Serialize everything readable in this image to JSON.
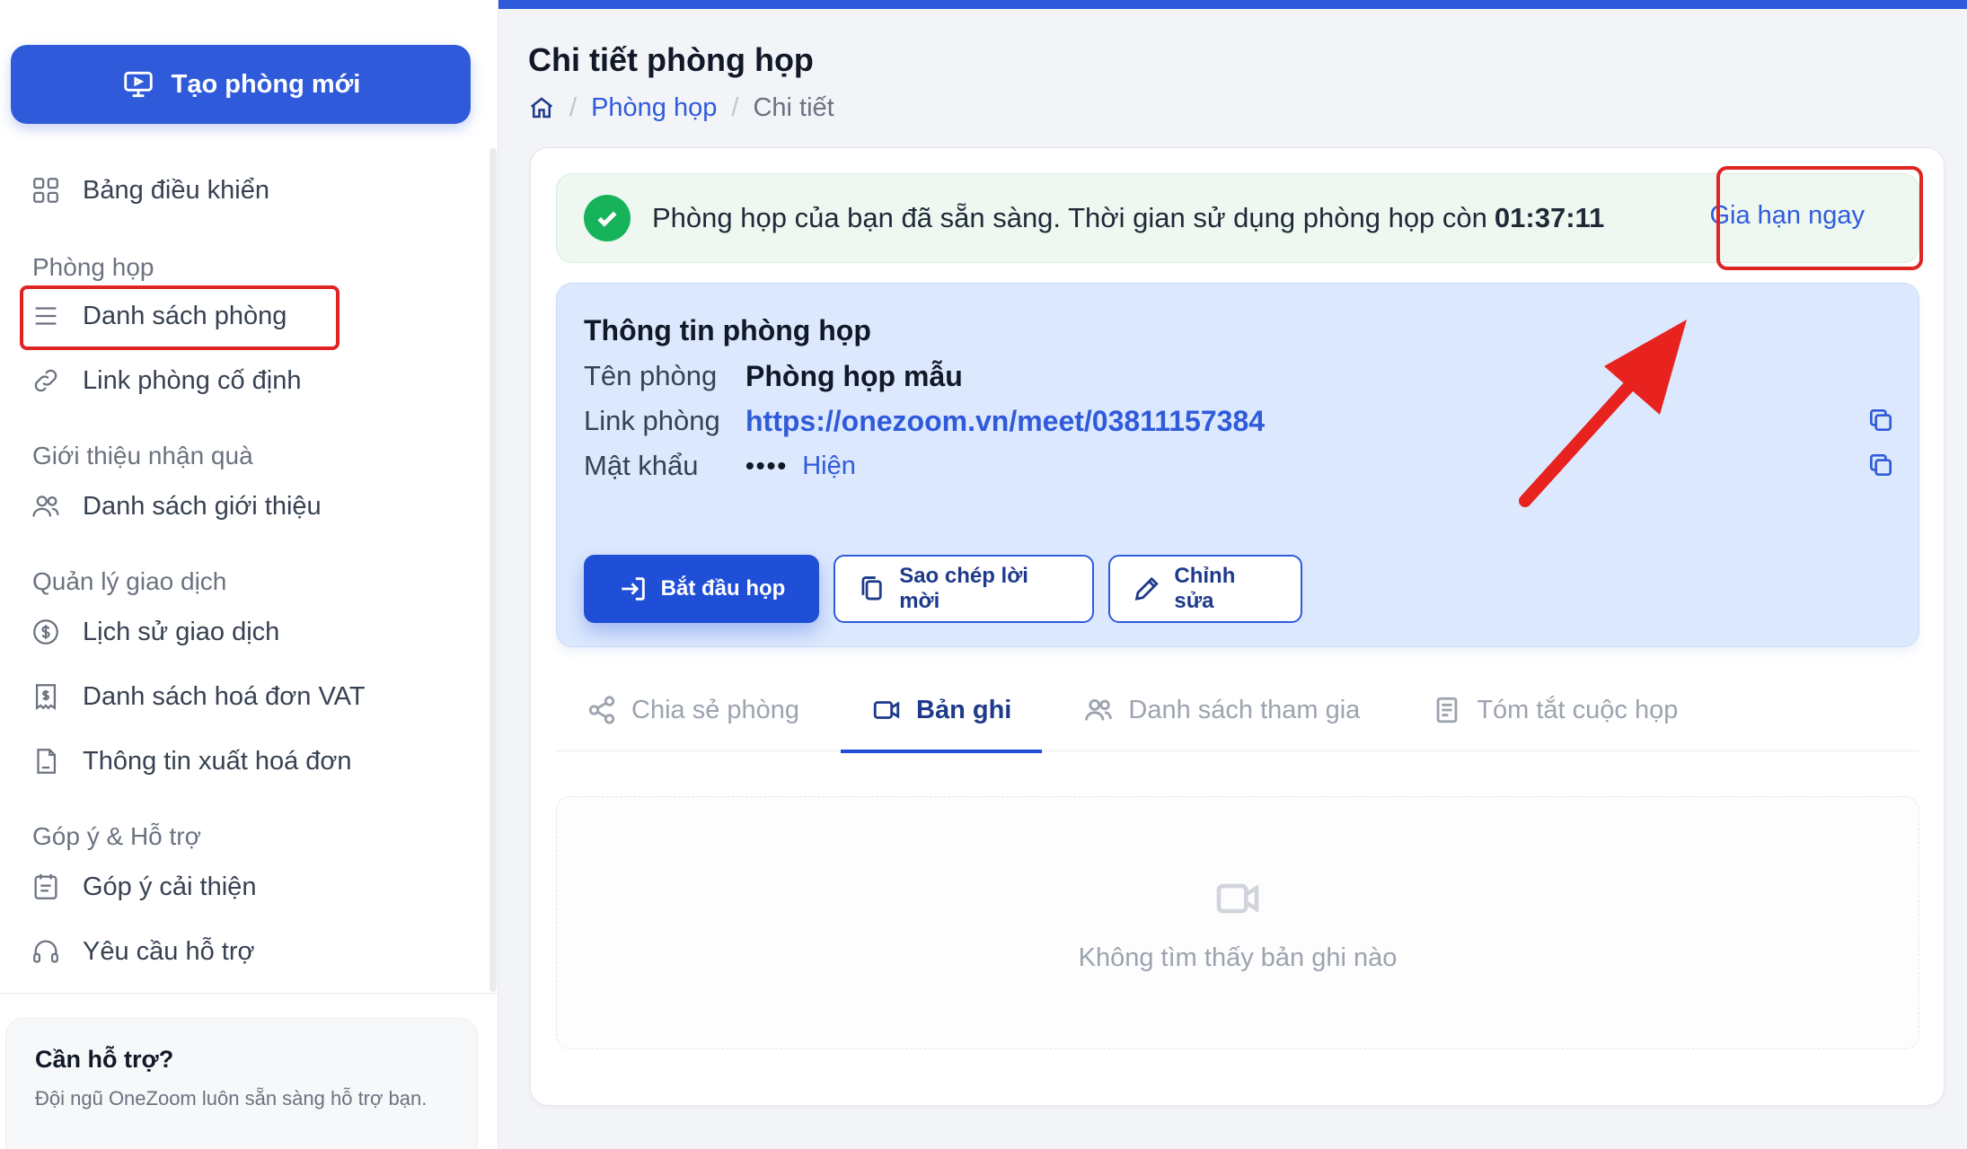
{
  "sidebar": {
    "create_button": "Tạo phòng mới",
    "dashboard": "Bảng điều khiển",
    "sections": [
      {
        "title": "Phòng họp",
        "items": [
          "Danh sách phòng",
          "Link phòng cố định"
        ]
      },
      {
        "title": "Giới thiệu nhận quà",
        "items": [
          "Danh sách giới thiệu"
        ]
      },
      {
        "title": "Quản lý giao dịch",
        "items": [
          "Lịch sử giao dịch",
          "Danh sách hoá đơn VAT",
          "Thông tin xuất hoá đơn"
        ]
      },
      {
        "title": "Góp ý & Hỗ trợ",
        "items": [
          "Góp ý cải thiện",
          "Yêu cầu hỗ trợ"
        ]
      }
    ],
    "help": {
      "title": "Cần hỗ trợ?",
      "text": "Đội ngũ OneZoom luôn sẵn sàng hỗ trợ bạn."
    }
  },
  "header": {
    "title": "Chi tiết phòng họp",
    "breadcrumb": [
      "Phòng họp",
      "Chi tiết"
    ]
  },
  "alert": {
    "text": "Phòng họp của bạn đã sẵn sàng. Thời gian sử dụng phòng họp còn",
    "time": "01:37:11",
    "extend": "Gia hạn ngay"
  },
  "room_info": {
    "title": "Thông tin phòng họp",
    "name_label": "Tên phòng",
    "name_value": "Phòng họp mẫu",
    "link_label": "Link phòng",
    "link_value": "https://onezoom.vn/meet/03811157384",
    "password_label": "Mật khẩu",
    "password_mask": "••••",
    "reveal": "Hiện",
    "buttons": {
      "start": "Bắt đầu họp",
      "copy_invite": "Sao chép lời mời",
      "edit": "Chỉnh sửa"
    }
  },
  "tabs": [
    {
      "label": "Chia sẻ phòng",
      "icon": "share-icon"
    },
    {
      "label": "Bản ghi",
      "icon": "video-icon",
      "active": true
    },
    {
      "label": "Danh sách tham gia",
      "icon": "users-icon"
    },
    {
      "label": "Tóm tắt cuộc họp",
      "icon": "document-icon"
    }
  ],
  "empty_state": "Không tìm thấy bản ghi nào",
  "colors": {
    "primary": "#2f5bdb",
    "success": "#16b35a",
    "highlight": "#e02424"
  }
}
